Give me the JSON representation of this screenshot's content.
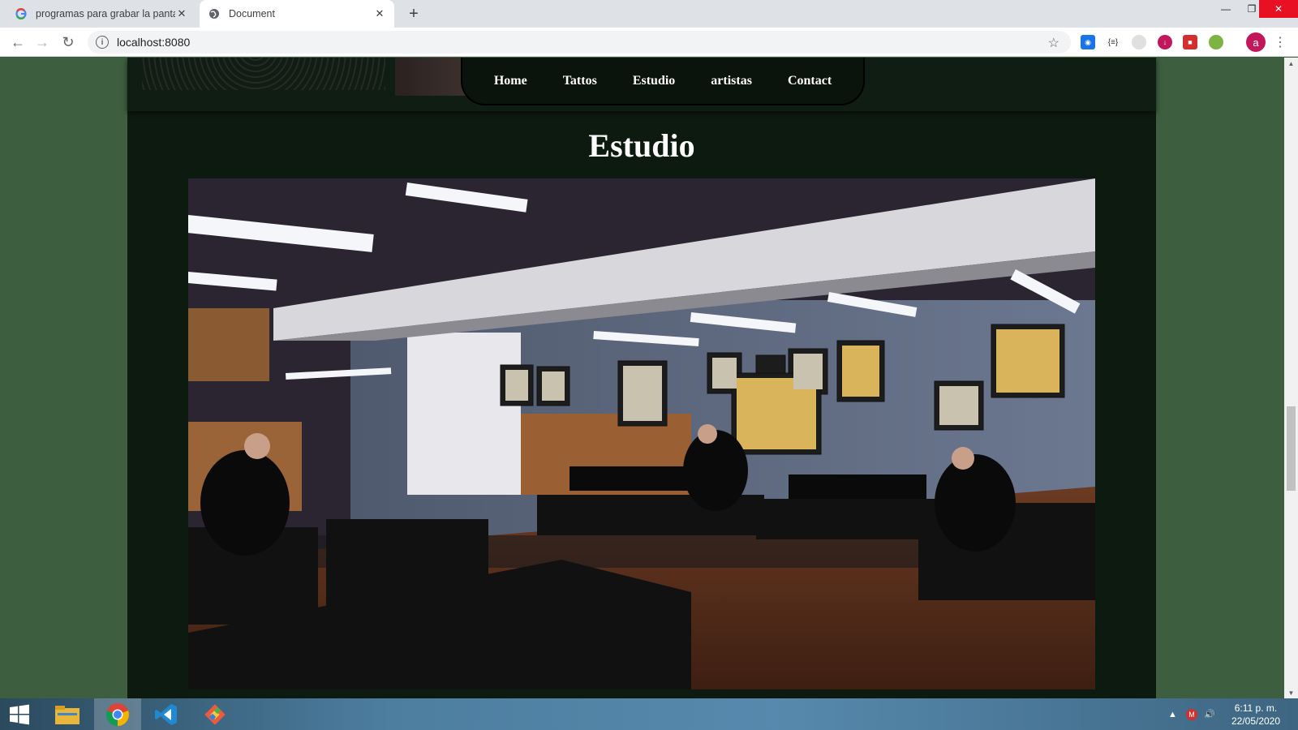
{
  "browser": {
    "tabs": [
      {
        "title": "programas para grabar la pantall",
        "favicon": "google-icon",
        "active": false
      },
      {
        "title": "Document",
        "favicon": "globe-icon",
        "active": true
      }
    ],
    "address": "localhost:8080"
  },
  "site": {
    "nav": [
      "Home",
      "Tattos",
      "Estudio",
      "artistas",
      "Contact"
    ],
    "section_title": "Estudio"
  },
  "taskbar": {
    "apps": [
      "windows-start-icon",
      "file-explorer-icon",
      "chrome-icon",
      "vscode-icon",
      "git-icon"
    ],
    "time": "6:11 p. m.",
    "date": "22/05/2020"
  },
  "colors": {
    "page_bg": "#3d5e3f",
    "content_bg": "#0d1a10",
    "accent_close": "#e81123",
    "avatar": "#c2185b"
  }
}
